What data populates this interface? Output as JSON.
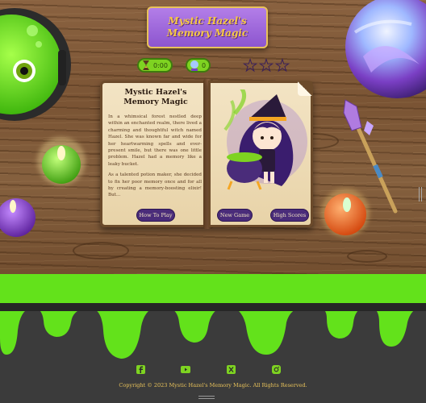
{
  "game": {
    "title": "Mystic Hazel's Memory Magic",
    "title_line1": "Mystic Hazel's",
    "title_line2": "Memory Magic"
  },
  "stats": {
    "timer_icon": "hourglass-icon",
    "timer_value": "0:00",
    "moves_icon": "crystal-ball-icon",
    "moves_value": "0",
    "stars_filled": 0,
    "stars_total": 3
  },
  "book": {
    "title": "Mystic Hazel's Memory Magic",
    "story": [
      "In a whimsical forest nestled deep within an enchanted realm, there lived a charming and thoughtful witch named Hazel. She was known far and wide for her heartwarming spells and ever-present smile, but there was one little problem. Hazel had a memory like a leaky bucket.",
      "As a talented potion maker, she decided to fix her poor memory once and for all by creating a memory-boosting elixir! But..."
    ],
    "how_to_play_label": "How To Play",
    "new_game_label": "New Game",
    "high_scores_label": "High Scores"
  },
  "footer": {
    "social_icons": [
      "facebook-icon",
      "youtube-icon",
      "x-icon",
      "instagram-icon"
    ],
    "copyright": "Copyright © 2023 Mystic Hazel's Memory Magic. All Rights Reserved."
  },
  "colors": {
    "slime": "#63e21b",
    "purple": "#4a2c7a",
    "gold": "#e8c25a",
    "wood": "#7a5434"
  }
}
